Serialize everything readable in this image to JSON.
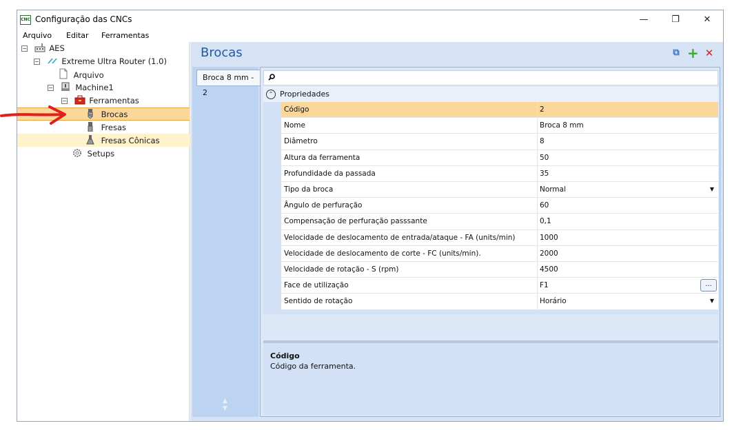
{
  "window": {
    "title": "Configuração das CNCs",
    "app_icon_text": "CNC",
    "controls": {
      "minimize": "—",
      "maximize": "❐",
      "close": "✕"
    }
  },
  "menu": [
    "Arquivo",
    "Editar",
    "Ferramentas"
  ],
  "tree": {
    "root": "AES",
    "machine_group": "Extreme Ultra Router (1.0)",
    "arquivo": "Arquivo",
    "machine": "Machine1",
    "ferramentas": "Ferramentas",
    "brocas": "Brocas",
    "fresas": "Fresas",
    "fresas_conicas": "Fresas Cônicas",
    "setups": "Setups",
    "expander_collapse": "−",
    "selected": "Brocas"
  },
  "panel": {
    "title": "Brocas",
    "toolbar": {
      "copy": "⧉",
      "add": "+",
      "remove": "✕"
    },
    "tabs": [
      "Broca 8 mm - 2"
    ],
    "tab_scroll": {
      "up": "▲",
      "down": "▼"
    }
  },
  "properties": {
    "category": "Propriedades",
    "category_toggle": "⌃",
    "rows": [
      {
        "name": "Código",
        "value": "2"
      },
      {
        "name": "Nome",
        "value": "Broca 8 mm"
      },
      {
        "name": "Diâmetro",
        "value": "8"
      },
      {
        "name": "Altura da ferramenta",
        "value": "50"
      },
      {
        "name": "Profundidade da passada",
        "value": "35"
      },
      {
        "name": "Tipo da broca",
        "value": "Normal"
      },
      {
        "name": "Ângulo de perfuração",
        "value": "60"
      },
      {
        "name": "Compensação de perfuração passsante",
        "value": "0,1"
      },
      {
        "name": "Velocidade de deslocamento de entrada/ataque - FA (units/min)",
        "value": "1000"
      },
      {
        "name": "Velocidade de deslocamento de corte - FC (units/min).",
        "value": "2000"
      },
      {
        "name": "Velocidade de rotação - S (rpm)",
        "value": "4500"
      },
      {
        "name": "Face de utilização",
        "value": "F1"
      },
      {
        "name": "Sentido de rotação",
        "value": "Horário"
      }
    ],
    "dropdown_arrow": "▼",
    "ellipsis": "..."
  },
  "description": {
    "title": "Código",
    "text": "Código da ferramenta."
  },
  "colors": {
    "accent": "#1f5aa6",
    "selection": "#fbd79b",
    "panel_bg": "#d6e3f5",
    "annotation_arrow": "#e0201c"
  }
}
